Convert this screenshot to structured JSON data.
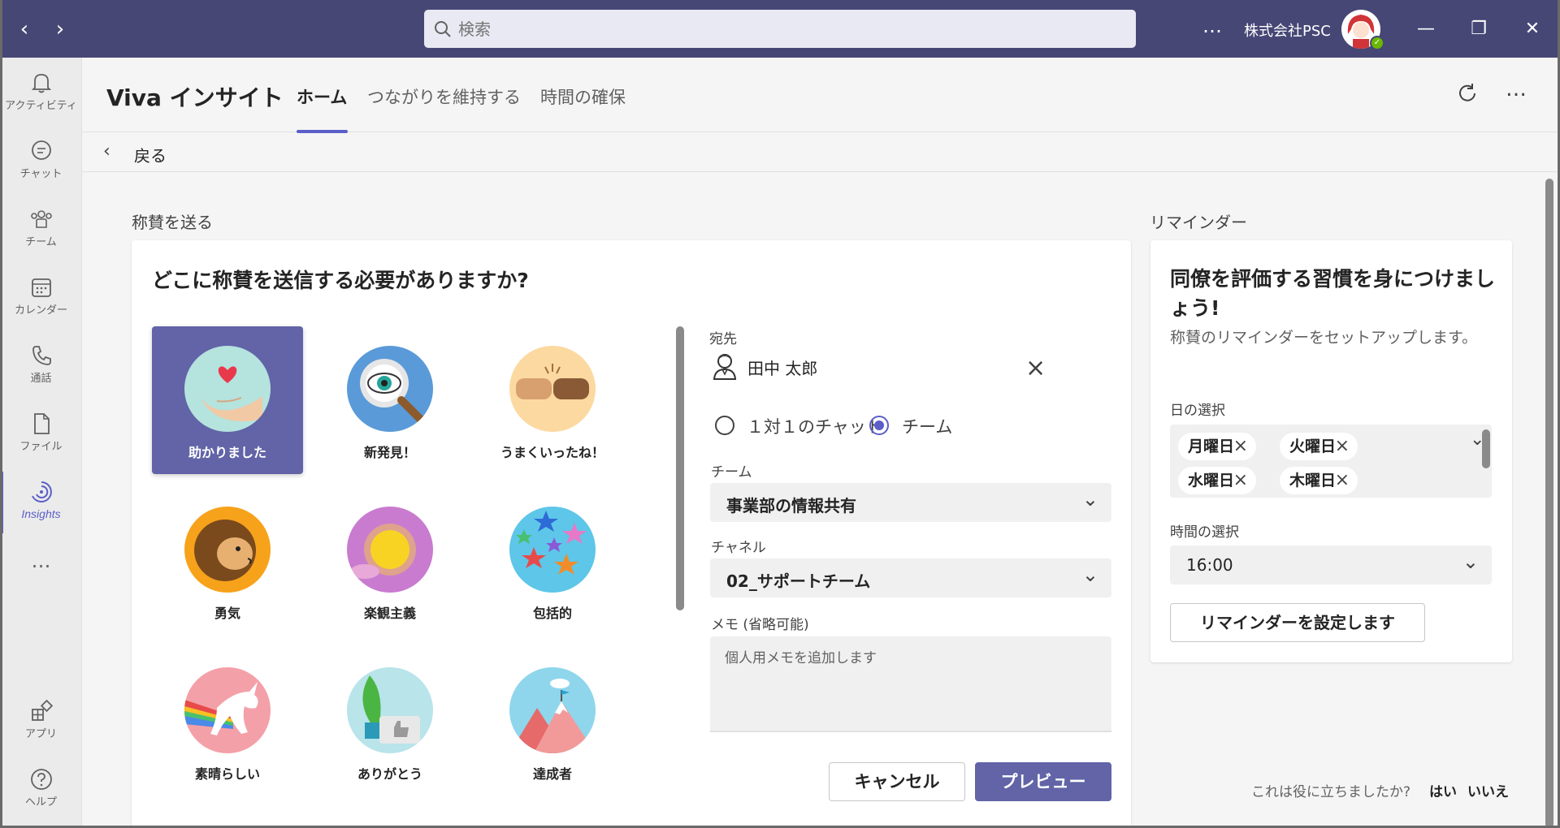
{
  "titlebar": {
    "search_placeholder": "検索",
    "org_name": "株式会社PSC",
    "more_label": "…"
  },
  "rail": {
    "items": [
      {
        "label": "アクティビティ",
        "icon": "bell-icon"
      },
      {
        "label": "チャット",
        "icon": "chat-icon"
      },
      {
        "label": "チーム",
        "icon": "teams-icon"
      },
      {
        "label": "カレンダー",
        "icon": "calendar-icon"
      },
      {
        "label": "通話",
        "icon": "phone-icon"
      },
      {
        "label": "ファイル",
        "icon": "file-icon"
      },
      {
        "label": "Insights",
        "icon": "insights-icon"
      },
      {
        "label": "アプリ",
        "icon": "apps-icon"
      },
      {
        "label": "ヘルプ",
        "icon": "help-icon"
      }
    ],
    "more": "…"
  },
  "header": {
    "app_title": "Viva インサイト",
    "tabs": [
      "ホーム",
      "つながりを維持する",
      "時間の確保"
    ]
  },
  "back": {
    "label": "戻る"
  },
  "praise": {
    "section_label": "称賛を送る",
    "question": "どこに称賛を送信する必要がありますか?",
    "badges": [
      "助かりました",
      "新発見！",
      "うまくいったね！",
      "勇気",
      "楽観主義",
      "包括的",
      "素晴らしい",
      "ありがとう",
      "達成者"
    ],
    "to_label": "宛先",
    "recipient": "田中 太郎",
    "radio_chat": "１対１のチャット",
    "radio_team": "チーム",
    "team_label": "チーム",
    "team_value": "事業部の情報共有",
    "channel_label": "チャネル",
    "channel_value": "02_サポートチーム",
    "memo_label": "メモ (省略可能)",
    "memo_placeholder": "個人用メモを追加します",
    "cancel": "キャンセル",
    "preview": "プレビュー"
  },
  "reminder": {
    "section_label": "リマインダー",
    "title": "同僚を評価する習慣を身につけましょう!",
    "desc": "称賛のリマインダーをセットアップします。",
    "day_label": "日の選択",
    "days": [
      "月曜日",
      "火曜日",
      "水曜日",
      "木曜日"
    ],
    "time_label": "時間の選択",
    "time_value": "16:00",
    "set_button": "リマインダーを設定します"
  },
  "feedback": {
    "question": "これは役に立ちましたか?",
    "yes": "はい",
    "no": "いいえ"
  },
  "colors": {
    "accent": "#6264a7",
    "titlebar": "#464775"
  }
}
